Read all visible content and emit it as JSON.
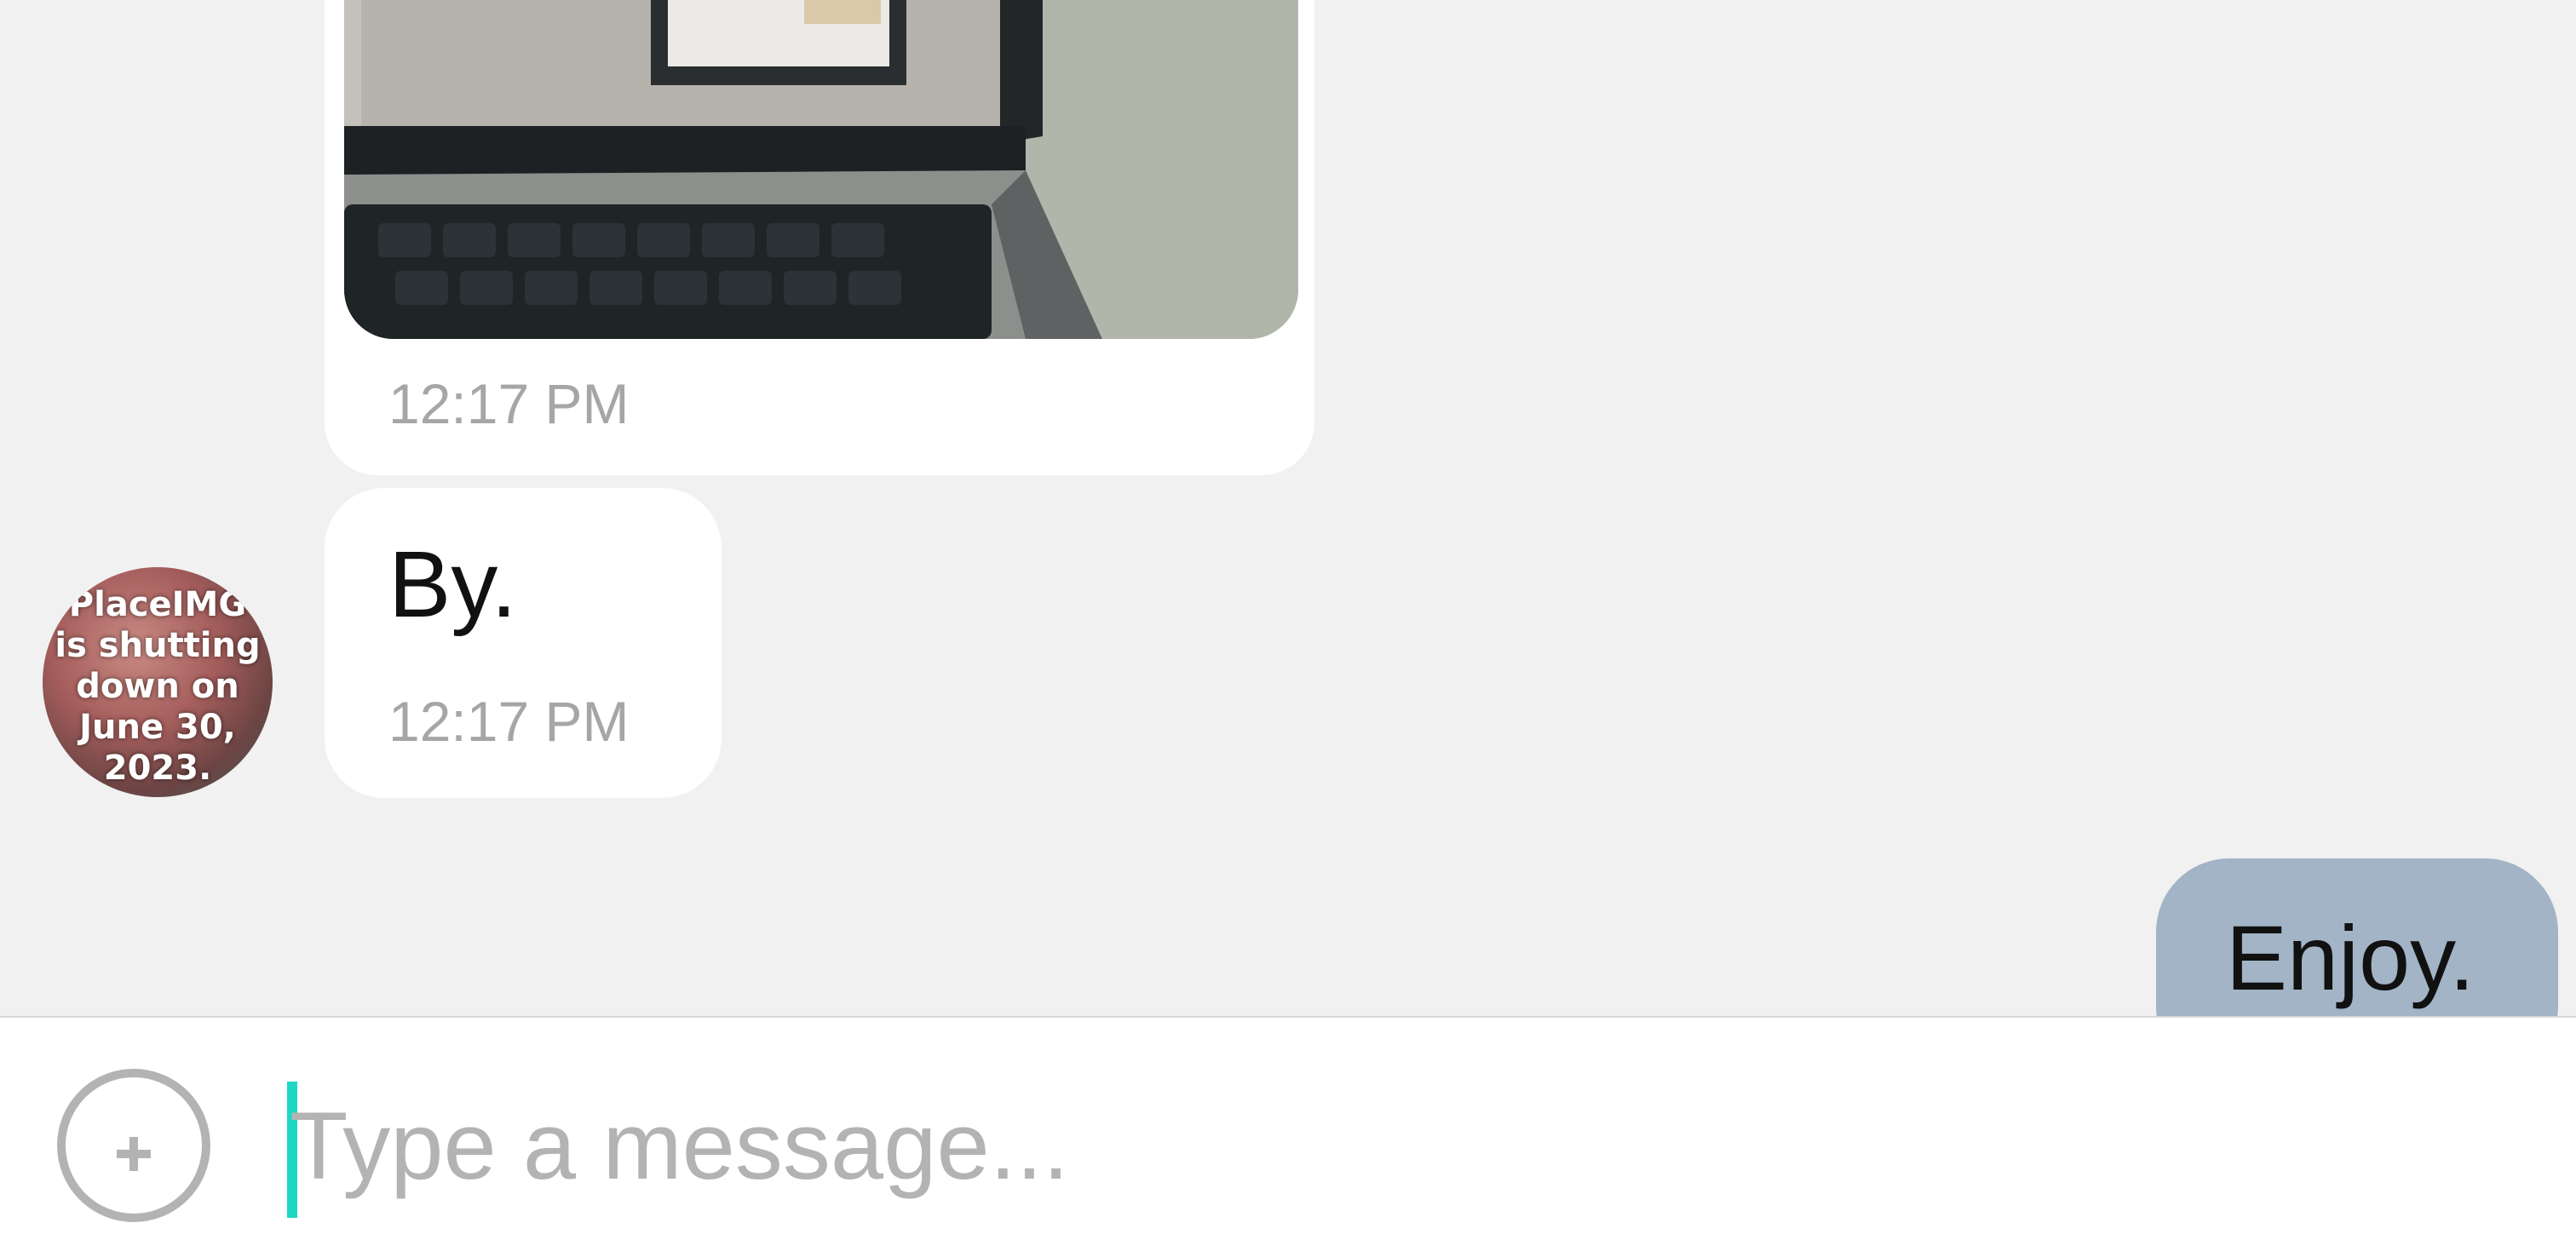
{
  "messages": [
    {
      "direction": "incoming",
      "kind": "image",
      "time": "12:17 PM"
    },
    {
      "direction": "incoming",
      "kind": "text",
      "text": "By.",
      "time": "12:17 PM"
    },
    {
      "direction": "outgoing",
      "kind": "text",
      "text": "Enjoy."
    }
  ],
  "avatar": {
    "text": "PlaceIMG\nis shutting\ndown on\nJune 30,\n2023."
  },
  "composer": {
    "placeholder": "Type a message...",
    "add_icon": "plus-circle-icon"
  },
  "colors": {
    "background": "#f1f1f1",
    "incoming_bubble": "#ffffff",
    "outgoing_bubble": "#a2b4c6",
    "time_text": "#a6a6a6",
    "cursor": "#1bd9c3"
  }
}
